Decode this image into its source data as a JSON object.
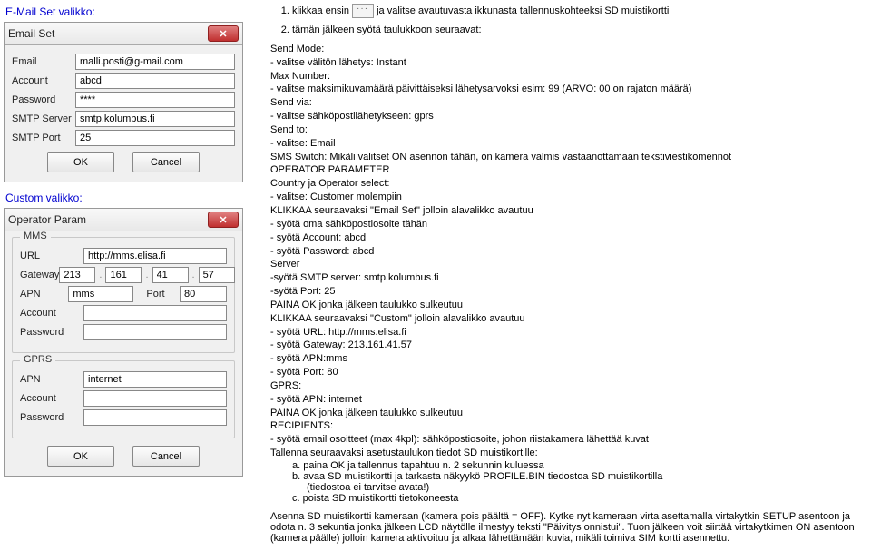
{
  "left": {
    "label1": "E-Mail Set valikko:",
    "label2": "Custom valikko:",
    "win1": {
      "title": "Email Set",
      "rows": {
        "email_lbl": "Email",
        "email_val": "malli.posti@g-mail.com",
        "account_lbl": "Account",
        "account_val": "abcd",
        "password_lbl": "Password",
        "password_val": "****",
        "smtp_lbl": "SMTP Server",
        "smtp_val": "smtp.kolumbus.fi",
        "port_lbl": "SMTP Port",
        "port_val": "25"
      },
      "ok": "OK",
      "cancel": "Cancel"
    },
    "win2": {
      "title": "Operator Param",
      "mms": {
        "legend": "MMS",
        "url_lbl": "URL",
        "url_val": "http://mms.elisa.fi",
        "gw_lbl": "Gateway",
        "gw1": "213",
        "gw2": "161",
        "gw3": "41",
        "gw4": "57",
        "apn_lbl": "APN",
        "apn_val": "mms",
        "port_lbl": "Port",
        "port_val": "80",
        "acc_lbl": "Account",
        "acc_val": "",
        "pwd_lbl": "Password",
        "pwd_val": ""
      },
      "gprs": {
        "legend": "GPRS",
        "apn_lbl": "APN",
        "apn_val": "internet",
        "acc_lbl": "Account",
        "acc_val": "",
        "pwd_lbl": "Password",
        "pwd_val": ""
      },
      "ok": "OK",
      "cancel": "Cancel"
    }
  },
  "right": {
    "li1a": "klikkaa ensin ",
    "li1b": " ja valitse avautuvasta ikkunasta tallennuskohteeksi SD muistikortti",
    "li2": "tämän jälkeen syötä taulukkoon seuraavat:",
    "lines": [
      "Send Mode:",
      " - valitse välitön lähetys: Instant",
      "Max Number:",
      " - valitse maksimikuvamäärä päivittäiseksi lähetysarvoksi esim: 99 (ARVO: 00 on rajaton määrä)",
      "Send via:",
      " - valitse sähköpostilähetykseen: gprs",
      "Send to:",
      " - valitse: Email",
      "SMS Switch: Mikäli valitset ON asennon tähän, on kamera valmis vastaanottamaan tekstiviestikomennot",
      "OPERATOR PARAMETER",
      "Country ja Operator select:",
      " - valitse: Customer molempiin",
      "KLIKKAA seuraavaksi \"Email Set\" jolloin alavalikko avautuu",
      " - syötä oma sähköpostiosoite tähän",
      " - syötä Account: abcd",
      " - syötä Password: abcd",
      "Server",
      " -syötä SMTP server: smtp.kolumbus.fi",
      " -syötä Port: 25",
      "PAINA OK jonka jälkeen taulukko sulkeutuu",
      "KLIKKAA seuraavaksi \"Custom\" jolloin alavalikko avautuu",
      " - syötä URL: http://mms.elisa.fi",
      " - syötä Gateway: 213.161.41.57",
      " - syötä APN:mms",
      " - syötä Port: 80",
      "GPRS:",
      " - syötä APN: internet",
      "PAINA OK jonka jälkeen taulukko sulkeutuu",
      "RECIPIENTS:",
      " - syötä email osoitteet (max 4kpl): sähköpostiosoite, johon riistakamera lähettää kuvat",
      "Tallenna seuraavaksi asetustaulukon tiedot SD muistikortille:"
    ],
    "sub_a": "a.  paina OK  ja tallennus tapahtuu n. 2 sekunnin kuluessa",
    "sub_b1": "b.  avaa SD muistikortti ja tarkasta näkyykö PROFILE.BIN tiedostoa SD muistikortilla",
    "sub_b2": "(tiedostoa ei tarvitse avata!)",
    "sub_c": "c.  poista SD muistikortti tietokoneesta",
    "footer": "Asenna SD muistikortti kameraan (kamera pois päältä = OFF). Kytke nyt kameraan virta asettamalla virtakytkin SETUP asentoon ja odota n. 3 sekuntia jonka jälkeen LCD näytölle ilmestyy teksti \"Päivitys onnistui\". Tuon jälkeen voit siirtää virtakytkimen ON asentoon (kamera päälle) jolloin kamera aktivoituu ja alkaa lähettämään kuvia, mikäli toimiva SIM kortti asennettu."
  }
}
